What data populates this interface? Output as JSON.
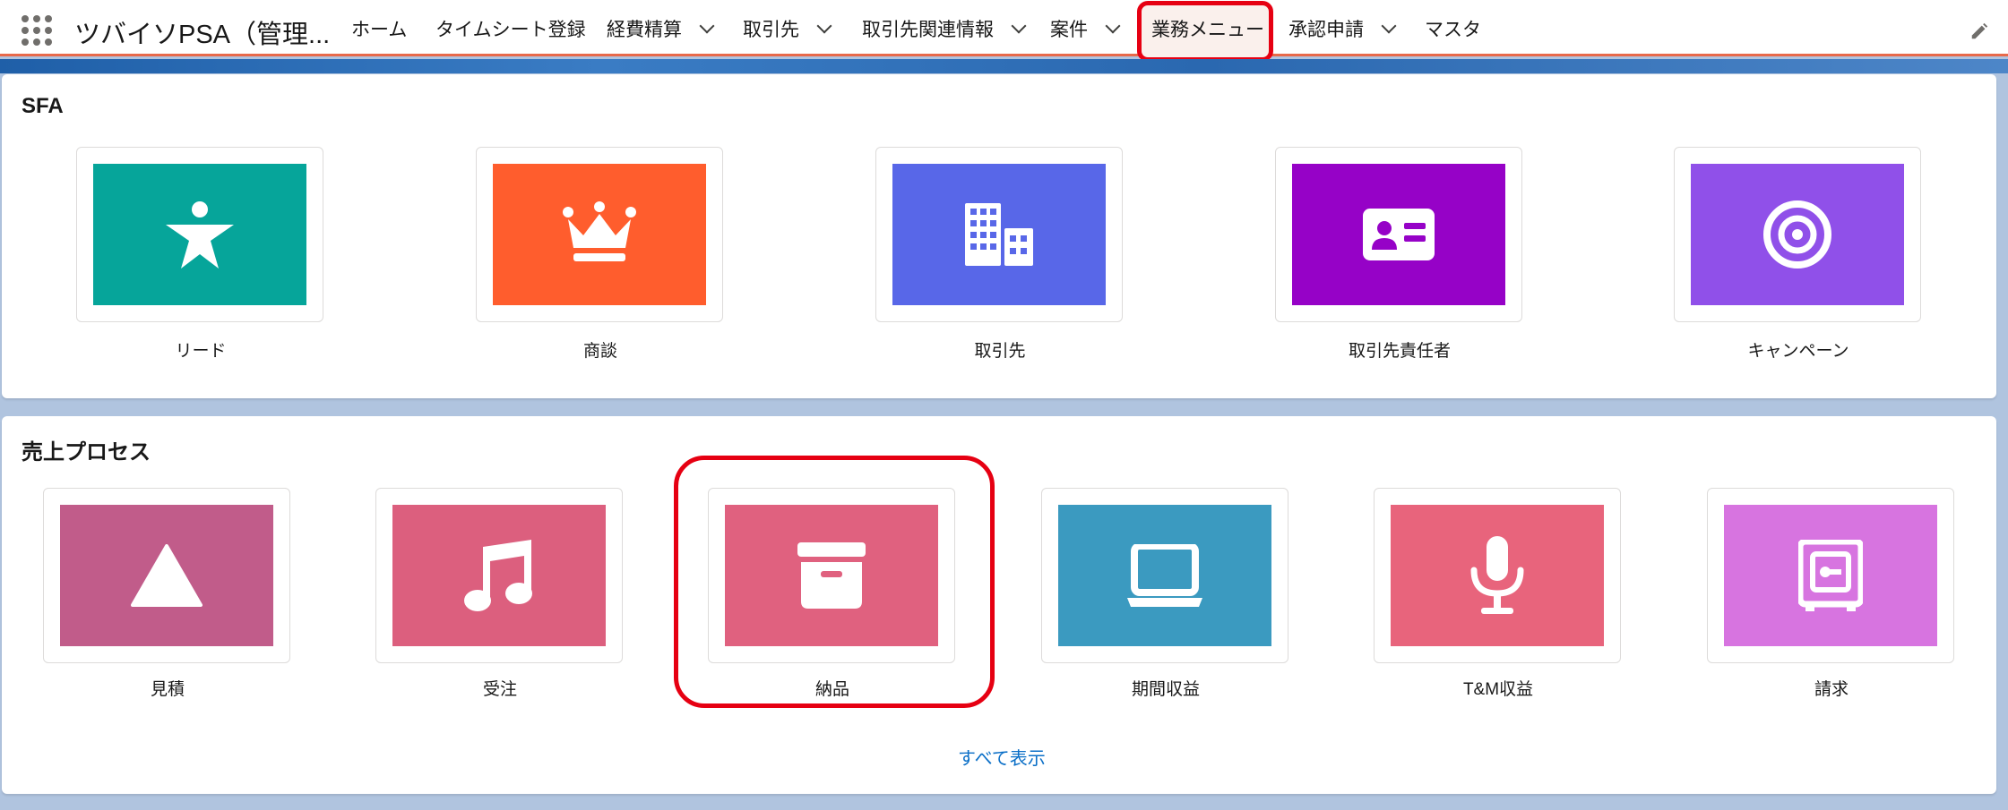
{
  "app": {
    "title": "ツバイソPSA（管理..."
  },
  "nav": {
    "home": "ホーム",
    "timesheet": "タイムシート登録",
    "expense": "経費精算",
    "accounts": "取引先",
    "account_related": "取引先関連情報",
    "projects": "案件",
    "business_menu": "業務メニュー",
    "approval": "承認申請",
    "master": "マスタ"
  },
  "sfa": {
    "title": "SFA",
    "tiles": [
      {
        "label": "リード",
        "icon": "lead-icon",
        "color": "#06a59a"
      },
      {
        "label": "商談",
        "icon": "opportunity-crown-icon",
        "color": "#ff5d2d"
      },
      {
        "label": "取引先",
        "icon": "account-building-icon",
        "color": "#5867e8"
      },
      {
        "label": "取引先責任者",
        "icon": "contact-card-icon",
        "color": "#9602c7"
      },
      {
        "label": "キャンペーン",
        "icon": "campaign-target-icon",
        "color": "#9050e9"
      }
    ]
  },
  "sales": {
    "title": "売上プロセス",
    "tiles": [
      {
        "label": "見積",
        "icon": "quote-triangle-icon",
        "color": "#c15c8a"
      },
      {
        "label": "受注",
        "icon": "order-music-icon",
        "color": "#dc5f7e"
      },
      {
        "label": "納品",
        "icon": "delivery-archive-icon",
        "color": "#e0617f"
      },
      {
        "label": "期間収益",
        "icon": "laptop-icon",
        "color": "#3b9ac0"
      },
      {
        "label": "T&M収益",
        "icon": "microphone-icon",
        "color": "#e8647c"
      },
      {
        "label": "請求",
        "icon": "invoice-safe-icon",
        "color": "#d774e0"
      }
    ],
    "show_all": "すべて表示"
  }
}
